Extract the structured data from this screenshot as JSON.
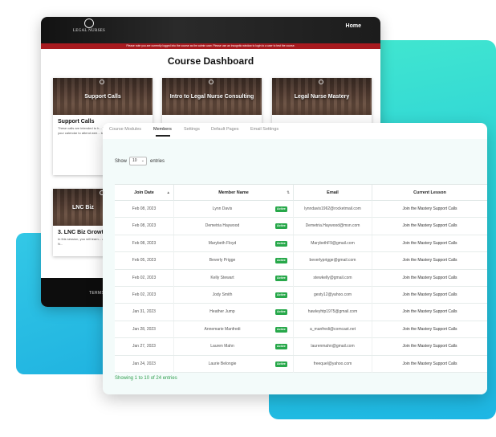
{
  "back_window": {
    "logo_text": "LEGAL NURSES",
    "logo_subtext": "",
    "nav_home": "Home",
    "notice": "Please note you are currently logged into the course as the admin user. Please use an incognito window to login to a user to test the course.",
    "title": "Course Dashboard",
    "cards": [
      {
        "banner": "Support Calls",
        "title": "Support Calls",
        "text": "These calls are intended to h... They need to be made a prior... your calendar to attend wee... to work, they will be recorde..."
      },
      {
        "banner": "Intro to Legal Nurse Consulting",
        "title": "",
        "text": ""
      },
      {
        "banner": "Legal Nurse Mastery",
        "title": "",
        "text": ""
      },
      {
        "banner": "LNC Biz",
        "title": "3. LNC Biz Growth",
        "text": "In this session, you will learn... and grow a successful Legal N..."
      }
    ],
    "footer_terms": "TERMS"
  },
  "front_window": {
    "tabs": [
      "Course Modules",
      "Members",
      "Settings",
      "Default Pages",
      "Email Settings"
    ],
    "active_tab": "Members",
    "show_label": "Show",
    "show_value": "10",
    "entries_label": "entries",
    "columns": [
      "Join Date",
      "Member Name",
      "Email",
      "Current Lesson"
    ],
    "rows": [
      {
        "date": "Feb 08, 2023",
        "name": "Lynn Davis",
        "status": "Active",
        "email": "lynndavis1962@rocketmail.com",
        "lesson": "Join the Mastery Support Calls"
      },
      {
        "date": "Feb 08, 2023",
        "name": "Demetria Haywood",
        "status": "Active",
        "email": "Demetria.Haywood@msn.com",
        "lesson": "Join the Mastery Support Calls"
      },
      {
        "date": "Feb 08, 2023",
        "name": "Marybeth Floyd",
        "status": "Active",
        "email": "MarybethF9@gmail.com",
        "lesson": "Join the Mastery Support Calls"
      },
      {
        "date": "Feb 05, 2023",
        "name": "Beverly Prigge",
        "status": "Active",
        "email": "beverlyprigge@gmail.com",
        "lesson": "Join the Mastery Support Calls"
      },
      {
        "date": "Feb 02, 2023",
        "name": "Kelly Stewart",
        "status": "Active",
        "email": "stewkelly@gmail.com",
        "lesson": "Join the Mastery Support Calls"
      },
      {
        "date": "Feb 02, 2023",
        "name": "Jody Smith",
        "status": "Active",
        "email": "gesty12@yahoo.com",
        "lesson": "Join the Mastery Support Calls"
      },
      {
        "date": "Jan 31, 2023",
        "name": "Heather Jump",
        "status": "Active",
        "email": "hawleyhtp1975@gmail.com",
        "lesson": "Join the Mastery Support Calls"
      },
      {
        "date": "Jan 28, 2023",
        "name": "Annemarie Manfredi",
        "status": "Active",
        "email": "a_manfredi@comcast.net",
        "lesson": "Join the Mastery Support Calls"
      },
      {
        "date": "Jan 27, 2023",
        "name": "Lauren Mahn",
        "status": "Active",
        "email": "laurenmahn@gmail.com",
        "lesson": "Join the Mastery Support Calls"
      },
      {
        "date": "Jan 24, 2023",
        "name": "Laurie Belongie",
        "status": "Active",
        "email": "freequel@yahoo.com",
        "lesson": "Join the Mastery Support Calls"
      }
    ],
    "showing_text": "Showing 1 to 10 of 24 entries"
  },
  "colors": {
    "accent_green": "#27a84a",
    "notice_red": "#a71a1f",
    "teal": "#2ad0d8"
  }
}
